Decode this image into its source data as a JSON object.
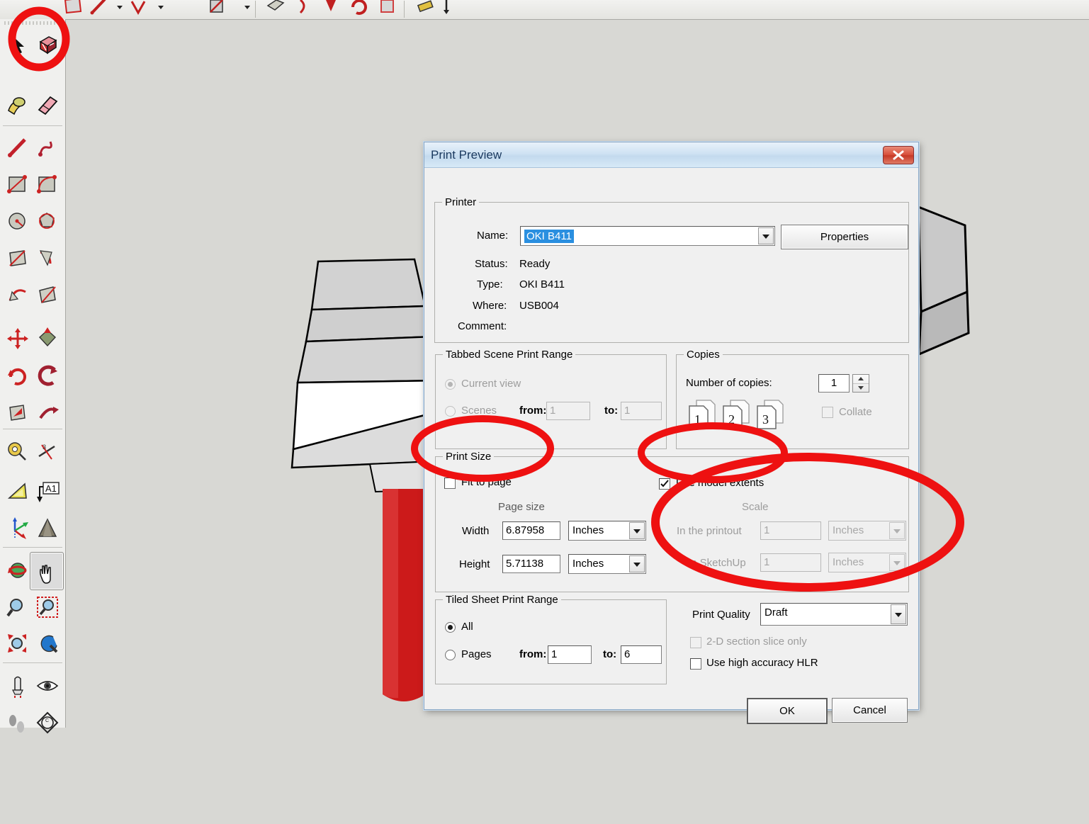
{
  "app": {
    "name": "SketchUp",
    "canvas_bg": "#d8d8d4",
    "toolbar_bg": "#f0f0ee"
  },
  "left_toolbar": {
    "name": "large-tool-set",
    "items": [
      {
        "name": "select-arrow-tool",
        "icon": "arrow-cursor-icon",
        "active": false
      },
      {
        "name": "eraser-tool",
        "icon": "eraser-icon",
        "active": false
      },
      {
        "name": "paint-bucket-tool",
        "icon": "paint-bucket-icon",
        "active": false
      },
      {
        "name": "eraser-pink-tool",
        "icon": "pink-eraser-icon",
        "active": false
      },
      {
        "name": "line-tool",
        "icon": "pencil-icon",
        "active": false
      },
      {
        "name": "freehand-tool",
        "icon": "freehand-squiggle-icon",
        "active": false
      },
      {
        "name": "rectangle-tool",
        "icon": "rectangle-icon",
        "active": false
      },
      {
        "name": "arc-tool",
        "icon": "arc-icon",
        "active": false
      },
      {
        "name": "circle-tool",
        "icon": "circle-icon",
        "active": false
      },
      {
        "name": "polygon-tool",
        "icon": "polygon-icon",
        "active": false
      },
      {
        "name": "push-pull-tool",
        "icon": "push-pull-icon",
        "active": false
      },
      {
        "name": "offset-tool",
        "icon": "offset-icon",
        "active": false
      },
      {
        "name": "follow-me-tool",
        "icon": "follow-me-icon",
        "active": false
      },
      {
        "name": "scale-tool",
        "icon": "scale-icon",
        "active": false
      },
      {
        "name": "move-tool",
        "icon": "move-arrows-icon",
        "active": false
      },
      {
        "name": "rotate-tool",
        "icon": "rotate-icon",
        "active": false
      },
      {
        "name": "rotate-red-tool",
        "icon": "rotate-red-icon",
        "active": false
      },
      {
        "name": "follow-me-red-tool",
        "icon": "follow-me-red-icon",
        "active": false
      },
      {
        "name": "push-pull-red-tool",
        "icon": "push-pull-red-icon",
        "active": false
      },
      {
        "name": "scale-red-tool",
        "icon": "scale-red-icon",
        "active": false
      },
      {
        "name": "tape-measure-tool",
        "icon": "tape-measure-icon",
        "active": false
      },
      {
        "name": "dimension-tool",
        "icon": "dimension-icon",
        "active": false
      },
      {
        "name": "protractor-tool",
        "icon": "protractor-icon",
        "active": false
      },
      {
        "name": "text-tool",
        "icon": "text-a1-icon",
        "active": false
      },
      {
        "name": "axes-tool",
        "icon": "axes-icon",
        "active": false
      },
      {
        "name": "3d-text-tool",
        "icon": "3d-text-icon",
        "active": false
      },
      {
        "name": "orbit-tool",
        "icon": "orbit-icon",
        "active": false
      },
      {
        "name": "pan-tool",
        "icon": "pan-hand-icon",
        "active": true
      },
      {
        "name": "zoom-tool",
        "icon": "magnifier-icon",
        "active": false
      },
      {
        "name": "zoom-window-tool",
        "icon": "zoom-window-icon",
        "active": false
      },
      {
        "name": "zoom-extents-tool",
        "icon": "zoom-extents-icon",
        "active": false
      },
      {
        "name": "previous-view-tool",
        "icon": "previous-view-icon",
        "active": false
      },
      {
        "name": "position-camera-tool",
        "icon": "position-camera-icon",
        "active": false
      },
      {
        "name": "look-around-tool",
        "icon": "eye-icon",
        "active": false
      },
      {
        "name": "walk-tool",
        "icon": "footprints-icon",
        "active": false
      },
      {
        "name": "section-plane-tool",
        "icon": "section-plane-icon",
        "active": false
      }
    ]
  },
  "dialog": {
    "title": "Print Preview",
    "close_label": "Close",
    "printer": {
      "group_label": "Printer",
      "name_label": "Name:",
      "name_value": "OKI B411",
      "properties_button": "Properties",
      "status_label": "Status:",
      "status_value": "Ready",
      "type_label": "Type:",
      "type_value": "OKI B411",
      "where_label": "Where:",
      "where_value": "USB004",
      "comment_label": "Comment:",
      "comment_value": ""
    },
    "tabbed_scene_print_range": {
      "group_label": "Tabbed Scene Print Range",
      "current_view_label": "Current view",
      "current_view_selected": true,
      "scenes_label": "Scenes",
      "scenes_selected": false,
      "from_label": "from:",
      "from_value": "1",
      "to_label": "to:",
      "to_value": "1"
    },
    "copies": {
      "group_label": "Copies",
      "number_label": "Number of copies:",
      "number_value": "1",
      "collate_label": "Collate",
      "collate_checked": false,
      "page_icons": [
        "1",
        "1",
        "2",
        "2",
        "3",
        "3"
      ]
    },
    "print_size": {
      "group_label": "Print Size",
      "fit_to_page_label": "Fit to page",
      "fit_to_page_checked": false,
      "use_model_extents_label": "Use model extents",
      "use_model_extents_checked": true,
      "page_size_label": "Page size",
      "scale_label": "Scale",
      "width_label": "Width",
      "width_value": "6.87958",
      "width_units": "Inches",
      "height_label": "Height",
      "height_value": "5.71138",
      "height_units": "Inches",
      "in_printout_label": "In the printout",
      "in_printout_value": "1",
      "in_printout_units": "Inches",
      "in_sketchup_label": "In SketchUp",
      "in_sketchup_value": "1",
      "in_sketchup_units": "Inches"
    },
    "tiled_sheet_print_range": {
      "group_label": "Tiled Sheet Print Range",
      "all_label": "All",
      "all_selected": true,
      "pages_label": "Pages",
      "pages_selected": false,
      "from_label": "from:",
      "from_value": "1",
      "to_label": "to:",
      "to_value": "6"
    },
    "quality": {
      "print_quality_label": "Print Quality",
      "print_quality_value": "Draft",
      "section_slice_label": "2-D section slice only",
      "section_slice_checked": false,
      "hlr_label": "Use high accuracy HLR",
      "hlr_checked": false
    },
    "footer": {
      "ok_label": "OK",
      "cancel_label": "Cancel"
    }
  },
  "annotations": {
    "color": "#ee1111",
    "marks": [
      {
        "name": "annotation-circle-paint-bucket-tool",
        "shape": "ellipse"
      },
      {
        "name": "annotation-ellipse-fit-to-page",
        "shape": "ellipse"
      },
      {
        "name": "annotation-ellipse-use-model-extents",
        "shape": "ellipse"
      },
      {
        "name": "annotation-ellipse-scale-fields",
        "shape": "ellipse"
      }
    ]
  }
}
